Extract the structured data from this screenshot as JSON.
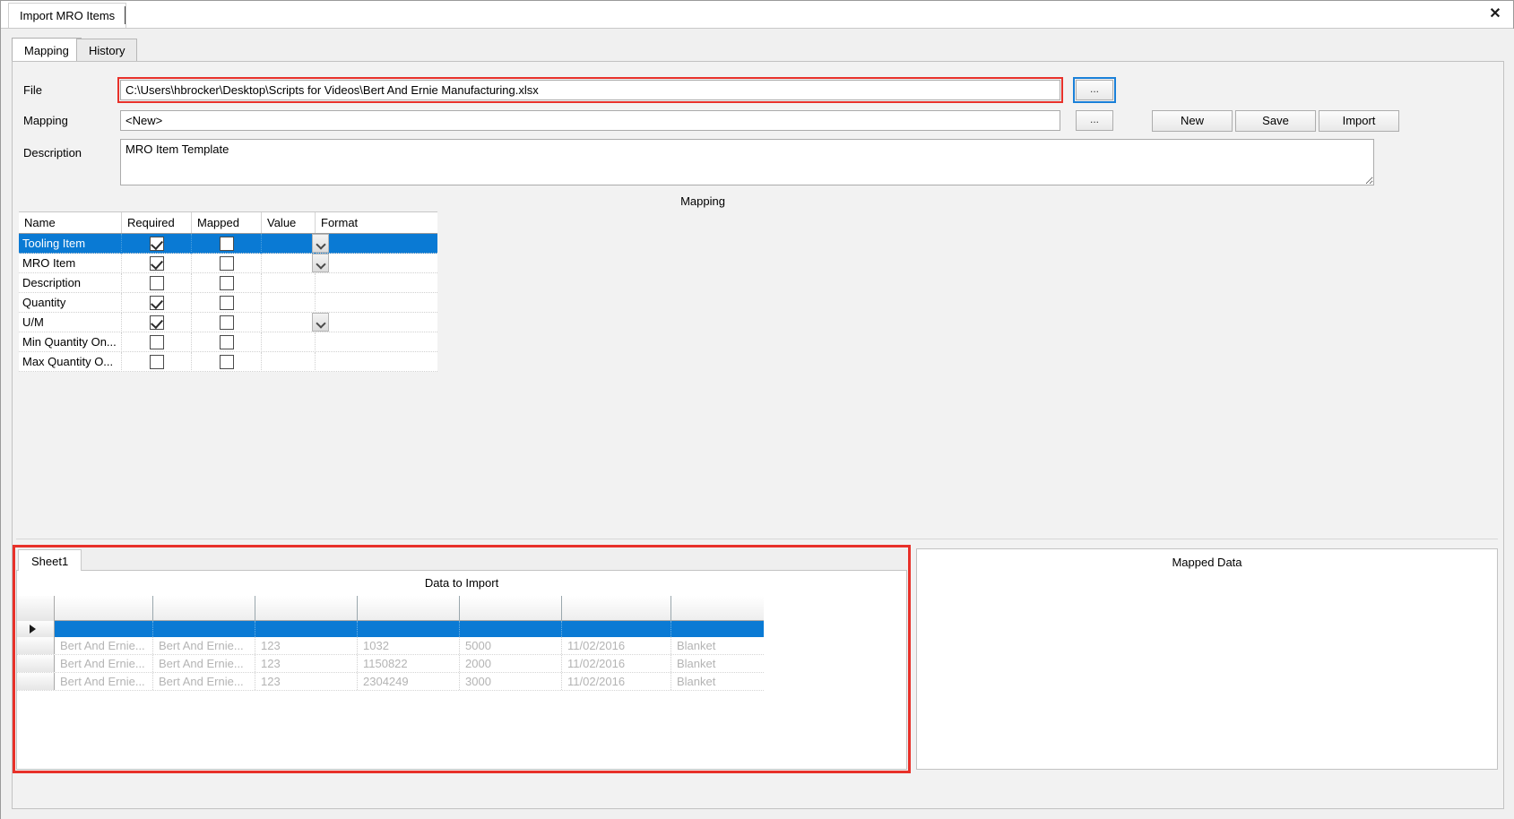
{
  "window": {
    "document_tab": "Import MRO Items",
    "close_icon": "close-icon",
    "close_glyph": "✕"
  },
  "tabs": [
    {
      "label": "Mapping",
      "active": true
    },
    {
      "label": "History",
      "active": false
    }
  ],
  "form": {
    "file": {
      "label": "File",
      "value": "C:\\Users\\hbrocker\\Desktop\\Scripts for Videos\\Bert And Ernie Manufacturing.xlsx",
      "placeholder": "",
      "browse_label": "...",
      "highlight_color": "#e8312a",
      "browse_focus_color": "#1a80d8"
    },
    "mapping": {
      "label": "Mapping",
      "value": "<New>",
      "placeholder": "",
      "browse_label": "..."
    },
    "description": {
      "label": "Description",
      "value": "MRO Item Template",
      "placeholder": ""
    }
  },
  "buttons": {
    "new": "New",
    "save": "Save",
    "import": "Import"
  },
  "mapping_section": {
    "title": "Mapping",
    "columns": [
      "Name",
      "Required",
      "Mapped",
      "Value",
      "Format"
    ],
    "rows": [
      {
        "name": "Tooling Item",
        "required": true,
        "mapped": false,
        "has_dropdown": true,
        "value": "",
        "format": "",
        "selected": true
      },
      {
        "name": "MRO Item",
        "required": true,
        "mapped": false,
        "has_dropdown": true,
        "value": "",
        "format": "",
        "selected": false
      },
      {
        "name": "Description",
        "required": false,
        "mapped": false,
        "has_dropdown": false,
        "value": "",
        "format": "",
        "selected": false
      },
      {
        "name": "Quantity",
        "required": true,
        "mapped": false,
        "has_dropdown": false,
        "value": "",
        "format": "",
        "selected": false
      },
      {
        "name": "U/M",
        "required": true,
        "mapped": false,
        "has_dropdown": true,
        "value": "",
        "format": "",
        "selected": false
      },
      {
        "name": "Min Quantity On...",
        "required": false,
        "mapped": false,
        "has_dropdown": false,
        "value": "",
        "format": "",
        "selected": false
      },
      {
        "name": "Max Quantity O...",
        "required": false,
        "mapped": false,
        "has_dropdown": false,
        "value": "",
        "format": "",
        "selected": false
      }
    ]
  },
  "data_section": {
    "sheet_tab": "Sheet1",
    "title": "Data to Import",
    "selected_row_index": 0,
    "rows": [
      {
        "a": "",
        "b": "",
        "c": "",
        "d": "",
        "e": "",
        "f": "",
        "g": "",
        "selected": true
      },
      {
        "a": "Bert And Ernie...",
        "b": "Bert And Ernie...",
        "c": "123",
        "d": "1032",
        "e": "5000",
        "f": "11/02/2016",
        "g": "Blanket",
        "selected": false
      },
      {
        "a": "Bert And Ernie...",
        "b": "Bert And Ernie...",
        "c": "123",
        "d": "1150822",
        "e": "2000",
        "f": "11/02/2016",
        "g": "Blanket",
        "selected": false
      },
      {
        "a": "Bert And Ernie...",
        "b": "Bert And Ernie...",
        "c": "123",
        "d": "2304249",
        "e": "3000",
        "f": "11/02/2016",
        "g": "Blanket",
        "selected": false
      }
    ]
  },
  "mapped_section": {
    "title": "Mapped Data"
  }
}
